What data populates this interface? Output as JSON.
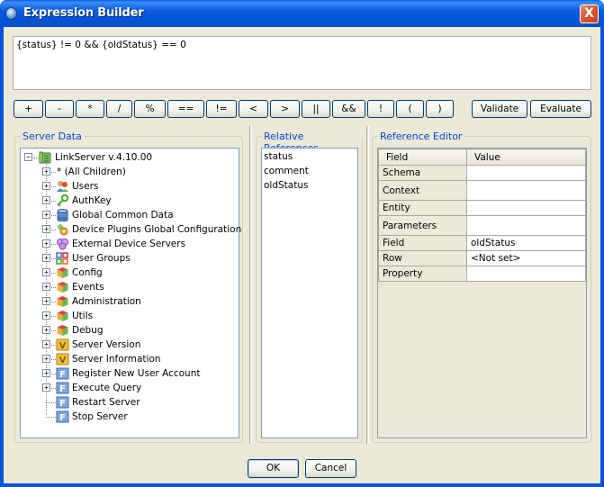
{
  "window": {
    "title": "Expression Builder",
    "close_label": "X"
  },
  "expression": {
    "value": "{status} != 0 && {oldStatus} == 0"
  },
  "operators": [
    "+",
    "-",
    "*",
    "/",
    "%",
    "==",
    "!=",
    "<",
    ">",
    "||",
    "&&",
    "!",
    "(",
    ")"
  ],
  "actions": {
    "validate": "Validate",
    "evaluate": "Evaluate"
  },
  "server_data": {
    "title": "Server Data",
    "root": {
      "label": "LinkServer v.4.10.00",
      "icon": "server-icon",
      "expanded": true
    },
    "items": [
      {
        "label": "* (All Children)",
        "icon": "none",
        "expandable": true
      },
      {
        "label": "Users",
        "icon": "users-icon",
        "expandable": true
      },
      {
        "label": "AuthKey",
        "icon": "key-icon",
        "expandable": true
      },
      {
        "label": "Global Common Data",
        "icon": "database-icon",
        "expandable": true
      },
      {
        "label": "Device Plugins Global Configuration",
        "icon": "plugins-icon",
        "expandable": true
      },
      {
        "label": "External Device Servers",
        "icon": "device-servers-icon",
        "expandable": true
      },
      {
        "label": "User Groups",
        "icon": "user-groups-icon",
        "expandable": true
      },
      {
        "label": "Config",
        "icon": "cube-icon",
        "expandable": true
      },
      {
        "label": "Events",
        "icon": "cube-icon",
        "expandable": true
      },
      {
        "label": "Administration",
        "icon": "cube-icon",
        "expandable": true
      },
      {
        "label": "Utils",
        "icon": "cube-icon",
        "expandable": true
      },
      {
        "label": "Debug",
        "icon": "cube-icon",
        "expandable": true
      },
      {
        "label": "Server Version",
        "icon": "variable-icon",
        "expandable": true
      },
      {
        "label": "Server Information",
        "icon": "variable-icon",
        "expandable": true
      },
      {
        "label": "Register New User Account",
        "icon": "function-icon",
        "expandable": true
      },
      {
        "label": "Execute Query",
        "icon": "function-icon",
        "expandable": true
      },
      {
        "label": "Restart Server",
        "icon": "function-icon",
        "expandable": false
      },
      {
        "label": "Stop Server",
        "icon": "function-icon",
        "expandable": false
      }
    ]
  },
  "relative_references": {
    "title": "Relative References",
    "items": [
      "status",
      "comment",
      "oldStatus"
    ]
  },
  "reference_editor": {
    "title": "Reference Editor",
    "columns": [
      "Field",
      "Value"
    ],
    "rows": [
      {
        "field": "Schema",
        "value": ""
      },
      {
        "field": "Context",
        "value": ""
      },
      {
        "field": "Entity",
        "value": ""
      },
      {
        "field": "Parameters",
        "value": ""
      },
      {
        "field": "Field",
        "value": "oldStatus"
      },
      {
        "field": "Row",
        "value": "<Not set>"
      },
      {
        "field": "Property",
        "value": ""
      }
    ]
  },
  "footer": {
    "ok": "OK",
    "cancel": "Cancel"
  },
  "colors": {
    "titlebar": "#0553d6",
    "group_title": "#0046d5",
    "dialog_bg": "#ece9d8",
    "close_button": "#d9582e"
  }
}
